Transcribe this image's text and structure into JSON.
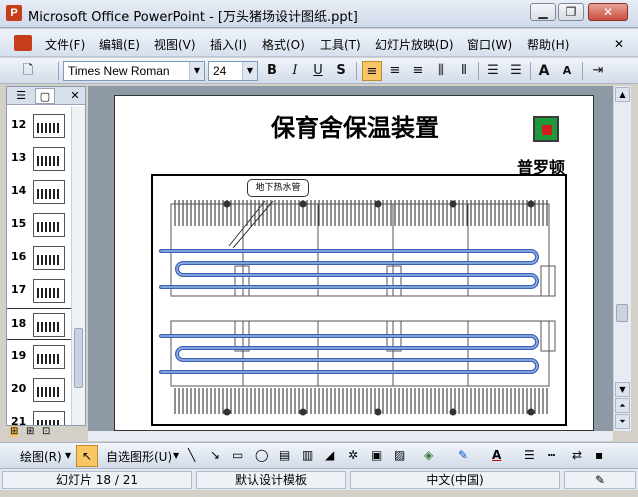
{
  "window": {
    "title": "Microsoft Office PowerPoint - [万头猪场设计图纸.ppt]",
    "app_icon": "P",
    "controls": [
      "minimize-icon",
      "restore-icon",
      "close-icon"
    ]
  },
  "menu": [
    "文件(F)",
    "编辑(E)",
    "视图(V)",
    "插入(I)",
    "格式(O)",
    "工具(T)",
    "幻灯片放映(D)",
    "窗口(W)",
    "帮助(H)"
  ],
  "toolbar": {
    "font_name": "Times New Roman",
    "font_size": "24",
    "bold": "B",
    "italic": "I",
    "underline": "U",
    "shadow": "S",
    "grow": "A",
    "shrink": "A"
  },
  "thumbnails": {
    "numbers": [
      "12",
      "13",
      "14",
      "15",
      "16",
      "17",
      "18",
      "19",
      "20",
      "21"
    ],
    "selected": "18"
  },
  "slide": {
    "title": "保育舍保温装置",
    "logo_text": "普罗顿",
    "callout": "地下热水管",
    "colors": {
      "pipe": "#3a62b8",
      "pipe_light": "#9ab4e6",
      "logo_green": "#1e9a3c",
      "logo_red": "#d21d1d"
    }
  },
  "drawbar": {
    "draw_label": "绘图(R)",
    "autoshapes_label": "自选图形(U)"
  },
  "status": {
    "slide_counter": "幻灯片 18 / 21",
    "template": "默认设计模板",
    "language": "中文(中国)"
  }
}
